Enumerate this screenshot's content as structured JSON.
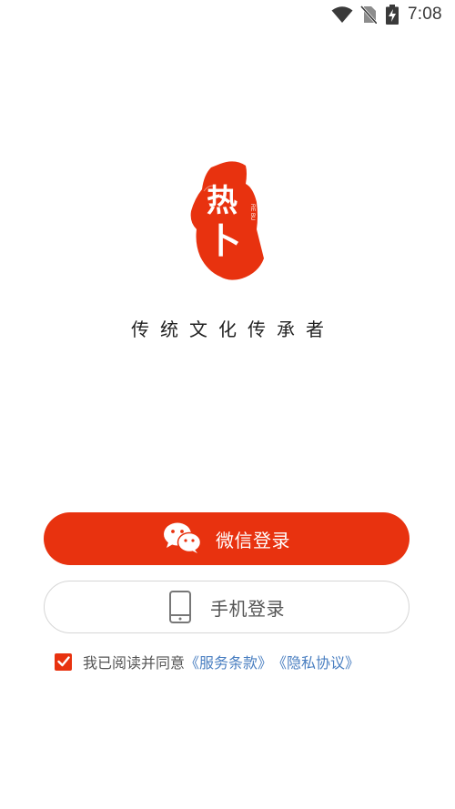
{
  "status_bar": {
    "time": "7:08",
    "icons": [
      "wifi-icon",
      "no-sim-icon",
      "battery-charging-icon"
    ]
  },
  "brand": {
    "logo_char_top": "热",
    "logo_char_bottom": "卜",
    "logo_pinyin": "RE BU",
    "slogan": "传统文化传承者",
    "accent_color": "#e8320f"
  },
  "buttons": {
    "wechat_label": "微信登录",
    "wechat_icon": "wechat-icon",
    "phone_label": "手机登录",
    "phone_icon": "mobile-phone-icon"
  },
  "agreement": {
    "checked": true,
    "prefix": "我已阅读并同意",
    "terms_link": "《服务条款》",
    "privacy_link": "《隐私协议》",
    "link_color": "#4a7fc1"
  }
}
